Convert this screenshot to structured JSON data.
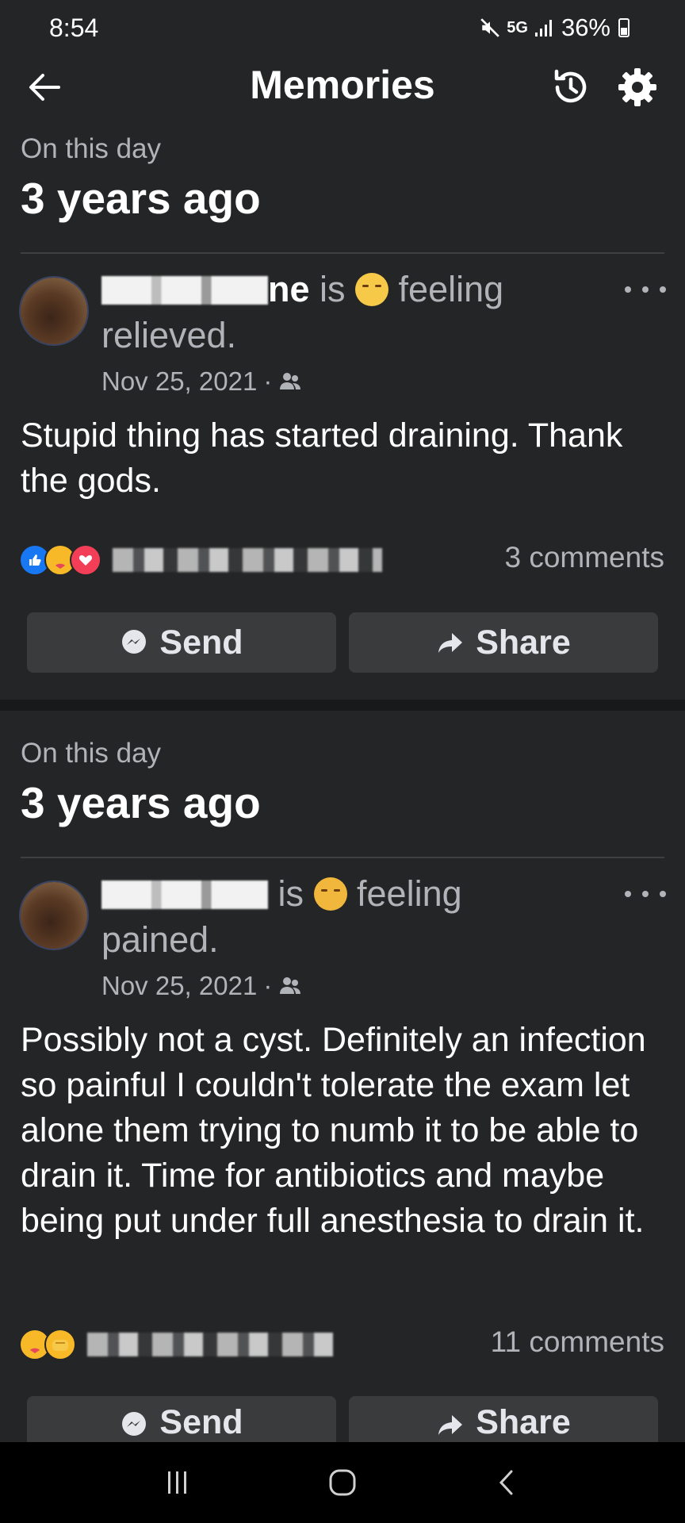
{
  "status_bar": {
    "time": "8:54",
    "network": "5G",
    "network_sub": "",
    "battery": "36%"
  },
  "header": {
    "title": "Memories",
    "icons": [
      "back-arrow-icon",
      "history-clock-icon",
      "gear-icon"
    ]
  },
  "memories": [
    {
      "section_sub": "On this day",
      "section_title": "3 years ago",
      "author_suffix": "ne",
      "connector": " is ",
      "feeling_word": "feeling",
      "feeling": "relieved.",
      "date": "Nov 25, 2021",
      "audience_icon": "friends-icon",
      "body": "Stupid thing has started draining. Thank the gods.",
      "reactions": [
        "like",
        "care",
        "love"
      ],
      "comments": "3 comments",
      "send_label": "Send",
      "share_label": "Share"
    },
    {
      "section_sub": "On this day",
      "section_title": "3 years ago",
      "author_suffix": "",
      "connector": " is ",
      "feeling_word": "feeling",
      "feeling": "pained.",
      "date": "Nov 25, 2021",
      "audience_icon": "friends-icon",
      "body": "Possibly not a cyst. Definitely an infection so painful I couldn't tolerate the exam let alone them trying to numb it to be able to drain it. Time for antibiotics and maybe being put under full anesthesia to drain it.",
      "reactions": [
        "care",
        "haha"
      ],
      "comments": "11 comments",
      "send_label": "Send",
      "share_label": "Share"
    }
  ],
  "colors": {
    "background": "#242526",
    "button": "#3a3b3c",
    "muted_text": "#b0b3b8",
    "like": "#1877f2",
    "love": "#f33e58",
    "care": "#f7b928"
  }
}
